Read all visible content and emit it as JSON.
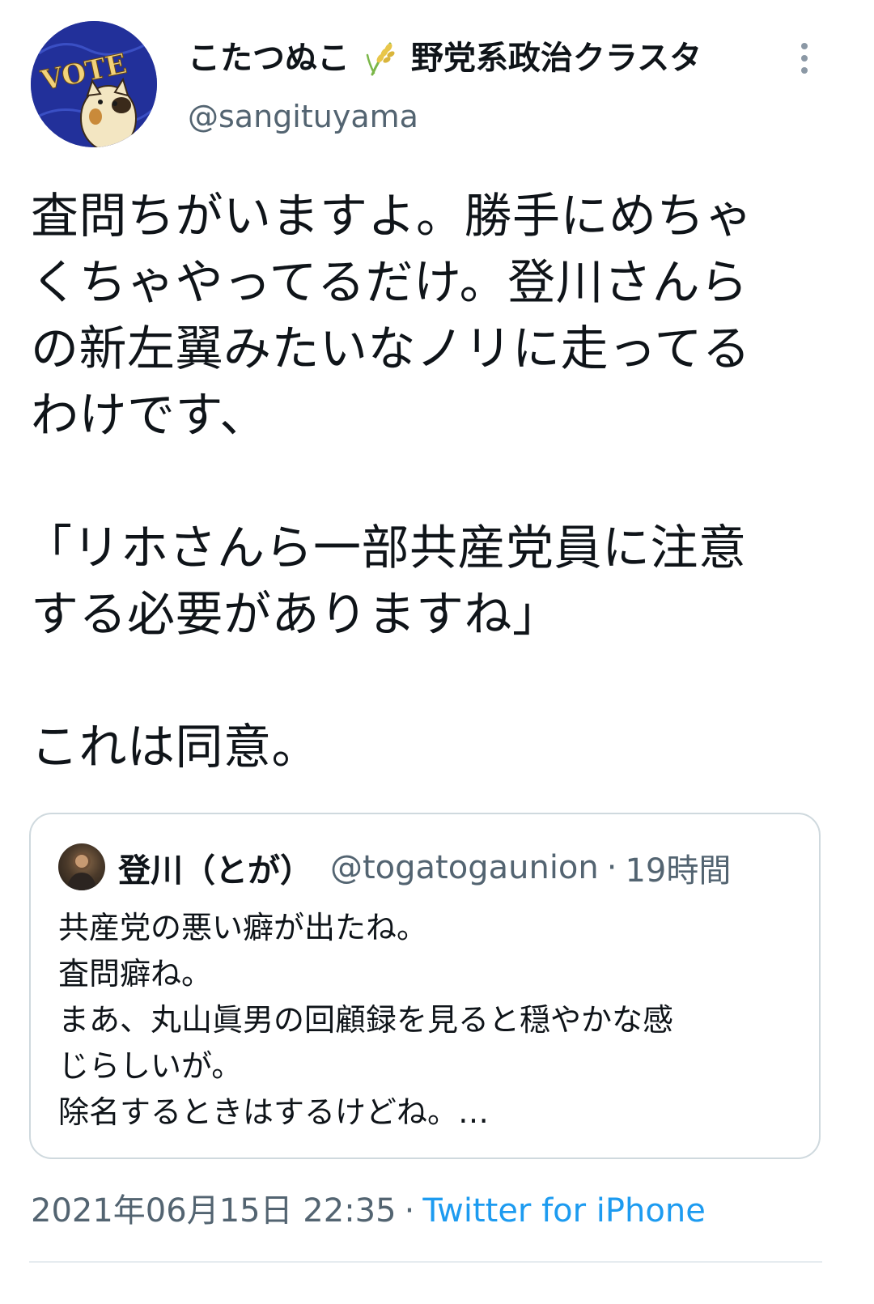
{
  "author": {
    "display_name": "こたつぬこ",
    "name_suffix": "野党系政治クラスタ",
    "emoji_icon": "rice-plant-icon",
    "handle": "@sangituyama"
  },
  "avatar": {
    "text": "VOTE",
    "bg_color": "#1f2e8a"
  },
  "tweet": {
    "lines": [
      "査問ちがいますよ。勝手にめちゃ",
      "くちゃやってるだけ。登川さんら",
      "の新左翼みたいなノリに走ってる",
      "わけです、",
      "",
      "「リホさんら一部共産党員に注意",
      "する必要がありますね」",
      "",
      "これは同意。"
    ]
  },
  "quote": {
    "name": "登川（とが）",
    "handle": "@togatogaunion",
    "separator": "·",
    "time": "19時間",
    "lines": [
      "共産党の悪い癖が出たね。",
      "査問癖ね。",
      "まあ、丸山眞男の回顧録を見ると穏やかな感",
      "じらしいが。",
      "除名するときはするけどね。…"
    ]
  },
  "meta": {
    "date": "2021年06月15日 22:35",
    "separator": "·",
    "source": "Twitter for iPhone"
  },
  "colors": {
    "text": "#0f1419",
    "secondary": "#536471",
    "link": "#1d9bf0",
    "border": "#cfd9de"
  }
}
